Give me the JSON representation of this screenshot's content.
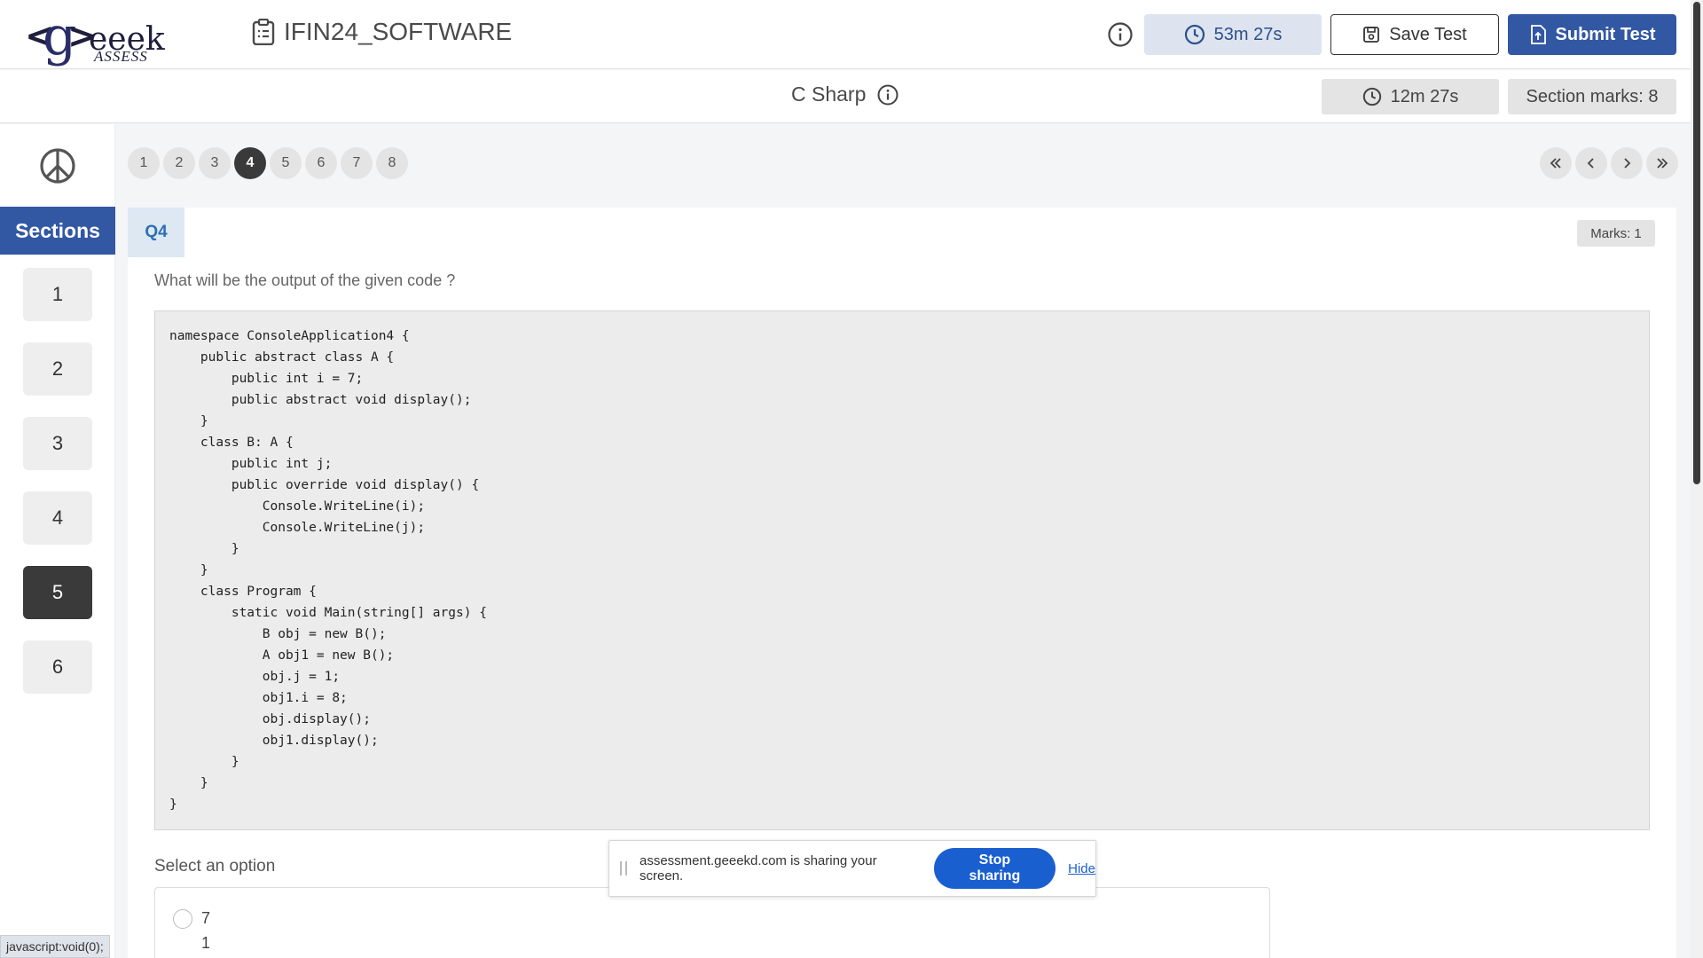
{
  "header": {
    "logo": {
      "left": "<",
      "g": "g",
      "right": ">",
      "eeek": "eeek",
      "assess": "ASSESS"
    },
    "test_title": "IFIN24_SOFTWARE",
    "timer": "53m 27s",
    "save_label": "Save Test",
    "submit_label": "Submit Test"
  },
  "section": {
    "name": "C Sharp",
    "timer": "12m 27s",
    "marks": "Section marks: 8"
  },
  "sidebar": {
    "sections_label": "Sections",
    "items": [
      "1",
      "2",
      "3",
      "4",
      "5",
      "6"
    ],
    "active_item": "5"
  },
  "question_nav": {
    "numbers": [
      "1",
      "2",
      "3",
      "4",
      "5",
      "6",
      "7",
      "8"
    ],
    "active": "4"
  },
  "question": {
    "tag": "Q4",
    "marks": "Marks: 1",
    "text": "What will be the output of the given code ?",
    "code": "namespace ConsoleApplication4 {\n    public abstract class A {\n        public int i = 7;\n        public abstract void display();\n    }\n    class B: A {\n        public int j;\n        public override void display() {\n            Console.WriteLine(i);\n            Console.WriteLine(j);\n        }\n    }\n    class Program {\n        static void Main(string[] args) {\n            B obj = new B();\n            A obj1 = new B();\n            obj.j = 1;\n            obj1.i = 8;\n            obj.display();\n            obj1.display();\n        }\n    }\n}",
    "select_label": "Select an option",
    "option1_line1": "7",
    "option1_line2": "1"
  },
  "share_banner": {
    "message": "assessment.geeekd.com is sharing your screen.",
    "stop_label": "Stop sharing",
    "hide_label": "Hide"
  },
  "status_url": "javascript:void(0);",
  "colors": {
    "primary": "#3257a3",
    "active_dark": "#3a3a3a",
    "share_blue": "#1a5fd0"
  }
}
